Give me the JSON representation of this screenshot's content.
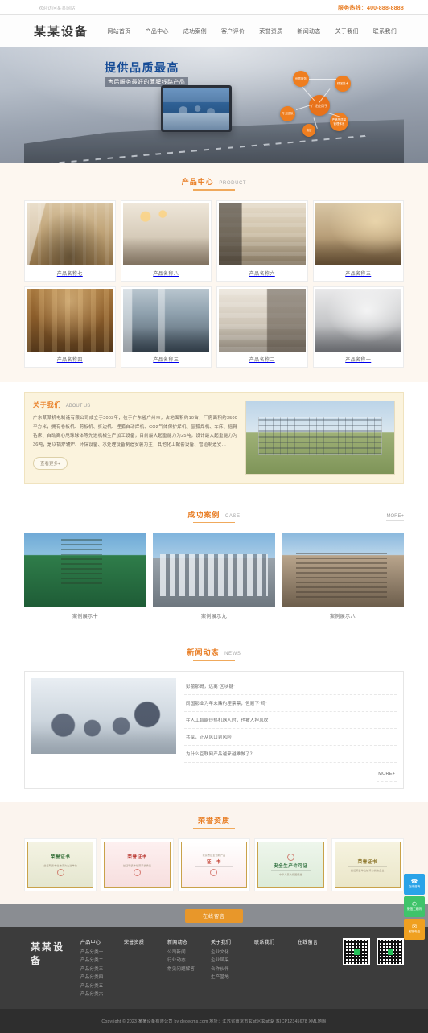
{
  "topbar": {
    "welcome": "欢迎访问某某网站",
    "hotline_label": "服务热线：",
    "hotline_number": "400-888-8888"
  },
  "header": {
    "logo": "某某设备",
    "nav": [
      {
        "label": "网站首页",
        "name": "nav-home"
      },
      {
        "label": "产品中心",
        "name": "nav-products"
      },
      {
        "label": "成功案例",
        "name": "nav-cases"
      },
      {
        "label": "客户评价",
        "name": "nav-reviews"
      },
      {
        "label": "荣誉资质",
        "name": "nav-honors"
      },
      {
        "label": "新闻动态",
        "name": "nav-news"
      },
      {
        "label": "关于我们",
        "name": "nav-about"
      },
      {
        "label": "联系我们",
        "name": "nav-contact"
      }
    ]
  },
  "banner": {
    "headline": "提供品质最高",
    "subheadline": "售后服务最好的薄膜线路产品",
    "bubbles": [
      {
        "text": "优质服务"
      },
      {
        "text": "精湛技术"
      },
      {
        "text": "广泛应用于"
      },
      {
        "text": "专业团队"
      },
      {
        "text": "严格的质量管理体系"
      },
      {
        "text": "诚信"
      }
    ]
  },
  "products": {
    "title_cn": "产品中心",
    "title_en": "PRODUCT",
    "items": [
      {
        "name": "产品名称七",
        "style": "i1"
      },
      {
        "name": "产品名称八",
        "style": "i2"
      },
      {
        "name": "产品名称六",
        "style": "i3"
      },
      {
        "name": "产品名称五",
        "style": "i4"
      },
      {
        "name": "产品名称四",
        "style": "i5"
      },
      {
        "name": "产品名称三",
        "style": "i6"
      },
      {
        "name": "产品名称二",
        "style": "i7"
      },
      {
        "name": "产品名称一",
        "style": "i8"
      }
    ]
  },
  "about": {
    "title_cn": "关于我们",
    "title_en": "ABOUT US",
    "text": "广东某某机电制造有限公司成立于2003年，位于广东省广州市，占地面积约10亩，厂房面积约3500平方米，拥有卷板机、剪板机、折边机、埋弧自动焊机、CO2气体保护焊机、氩弧焊机、车床、摇臂钻床、自动离心甩球球体等先进机械生产加工设备，目前最大起重能力为25吨，设计最大起重能力为36吨，是以锅炉辅炉、环保设备、水处理设备制造安装为主，其他化工配套设备、管道制造安…",
    "more_label": "查看更多+"
  },
  "cases": {
    "title_cn": "成功案例",
    "title_en": "CASE",
    "more_label": "MORE+",
    "items": [
      {
        "name": "案例展示十",
        "style": "cs1"
      },
      {
        "name": "案例展示九",
        "style": "cs2"
      },
      {
        "name": "案例展示八",
        "style": "cs3"
      }
    ]
  },
  "news": {
    "title_cn": "新闻动态",
    "title_en": "NEWS",
    "more_label": "MORE+",
    "items": [
      {
        "title": "彭蕾那哥，远离\"区块链\""
      },
      {
        "title": "同国影业为年末赌约埋票票，但顺下\"鸡\""
      },
      {
        "title": "在人工智能炒热机器人时，也被人担风吹"
      },
      {
        "title": "共享，正从风口到风险"
      },
      {
        "title": "为什么互联网产品越来越难做了？"
      }
    ]
  },
  "honor": {
    "title_cn": "荣誉资质",
    "items": [
      {
        "title": "荣誉证书",
        "sub": "兹证明贵单位被评为先进单位",
        "style": "h1"
      },
      {
        "title": "荣誉证书",
        "sub": "兹证明贵单位荣获优秀奖",
        "style": "h2"
      },
      {
        "title": "证　书",
        "sub": "北京市自主创新产品",
        "style": "h3"
      },
      {
        "title": "安全生产许可证",
        "sub": "中华人民共和国颁发",
        "style": "h4"
      },
      {
        "title": "荣誉证书",
        "sub": "兹证明贵单位被评为诚信企业",
        "style": "h5"
      }
    ]
  },
  "message_band": {
    "button_label": "在线留言"
  },
  "footer": {
    "logo": "某某设备",
    "columns": [
      {
        "head": "产品中心",
        "links": [
          "产品分类一",
          "产品分类二",
          "产品分类三",
          "产品分类四",
          "产品分类五",
          "产品分类六"
        ]
      },
      {
        "head": "荣誉资质",
        "links": []
      },
      {
        "head": "新闻动态",
        "links": [
          "公司新闻",
          "行业动态",
          "常见问题解答"
        ]
      },
      {
        "head": "关于我们",
        "links": [
          "企业文化",
          "企业风采",
          "合作伙伴",
          "生产基地"
        ]
      },
      {
        "head": "联系我们",
        "links": []
      },
      {
        "head": "在线留言",
        "links": []
      }
    ]
  },
  "copyright": {
    "text": "Copyright © 2023 某某设备有限公司 by dedecms.com 地址：江苏省南京市玄武区玄武湖 苏ICP12345678 XML地图"
  },
  "floatbar": {
    "buttons": [
      {
        "glyph": "☎",
        "label": "在线咨询",
        "style": "fb-blue",
        "name": "float-consult-button"
      },
      {
        "glyph": "✆",
        "label": "微信二维码",
        "style": "fb-green",
        "name": "float-wechat-button"
      },
      {
        "glyph": "✉",
        "label": "客服电话",
        "style": "fb-orange",
        "name": "float-phone-button"
      }
    ]
  },
  "colors": {
    "accent": "#e87b20",
    "accent_orange": "#f0a020",
    "footer_bg": "#3c3c3c",
    "copy_bg": "#2e2e2e",
    "band_bg": "#8a8d92",
    "about_bg": "#fbf3dd",
    "product_bg": "#fdf7f0"
  }
}
